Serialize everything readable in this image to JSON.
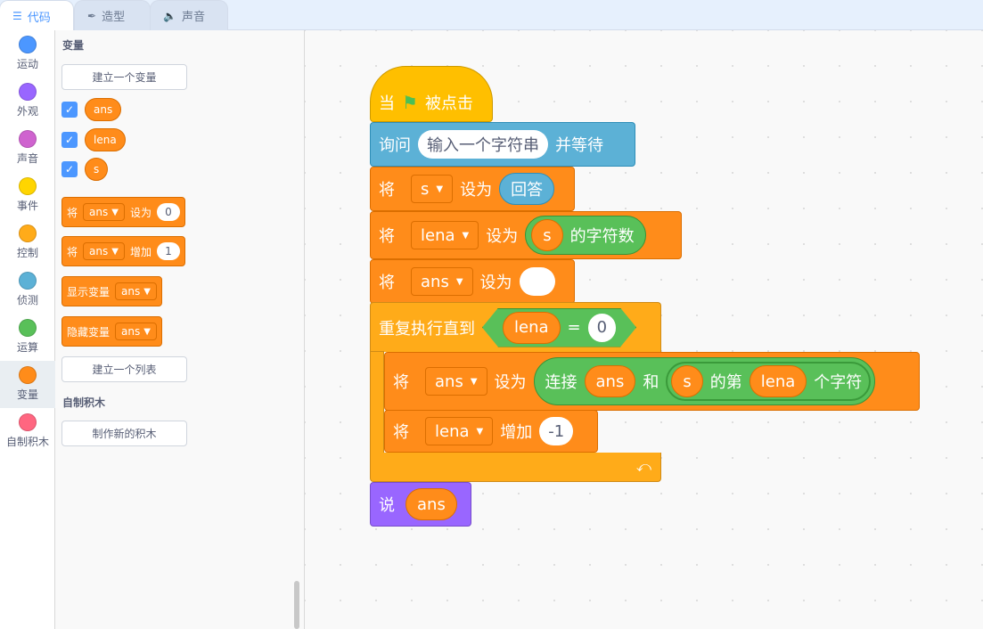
{
  "tabs": [
    {
      "label": "代码",
      "icon": "code-icon"
    },
    {
      "label": "造型",
      "icon": "brush-icon"
    },
    {
      "label": "声音",
      "icon": "speaker-icon"
    }
  ],
  "categories": [
    {
      "label": "运动",
      "color": "#4c97ff"
    },
    {
      "label": "外观",
      "color": "#9966ff"
    },
    {
      "label": "声音",
      "color": "#cf63cf"
    },
    {
      "label": "事件",
      "color": "#ffd500"
    },
    {
      "label": "控制",
      "color": "#ffab19"
    },
    {
      "label": "侦测",
      "color": "#5cb1d6"
    },
    {
      "label": "运算",
      "color": "#59c059"
    },
    {
      "label": "变量",
      "color": "#ff8c1a"
    },
    {
      "label": "自制积木",
      "color": "#ff6680"
    }
  ],
  "palette": {
    "section_variables": "变量",
    "make_variable": "建立一个变量",
    "variables": [
      "ans",
      "lena",
      "s"
    ],
    "set_block": {
      "verb": "将",
      "var": "ans",
      "op": "设为",
      "value": "0"
    },
    "change_block": {
      "verb": "将",
      "var": "ans",
      "op": "增加",
      "value": "1"
    },
    "show_block": {
      "label": "显示变量",
      "var": "ans"
    },
    "hide_block": {
      "label": "隐藏变量",
      "var": "ans"
    },
    "make_list": "建立一个列表",
    "section_myblocks": "自制积木",
    "make_block": "制作新的积木"
  },
  "script": {
    "hat": {
      "pre": "当",
      "post": "被点击"
    },
    "ask": {
      "label": "询问",
      "question": "输入一个字符串",
      "suffix": "并等待"
    },
    "set_s": {
      "verb": "将",
      "var": "s",
      "op": "设为",
      "value": "回答"
    },
    "set_lena": {
      "verb": "将",
      "var": "lena",
      "op": "设为",
      "inner": "s",
      "func": "的字符数"
    },
    "set_ans": {
      "verb": "将",
      "var": "ans",
      "op": "设为",
      "value": ""
    },
    "repeat": {
      "label": "重复执行直到",
      "left": "lena",
      "eq": "=",
      "right": "0"
    },
    "inner_set": {
      "verb": "将",
      "var": "ans",
      "op": "设为",
      "join": "连接",
      "a": "ans",
      "and": "和",
      "s": "s",
      "of": "的第",
      "idx": "lena",
      "char": "个字符"
    },
    "inner_change": {
      "verb": "将",
      "var": "lena",
      "op": "增加",
      "value": "-1"
    },
    "say": {
      "label": "说",
      "value": "ans"
    }
  }
}
